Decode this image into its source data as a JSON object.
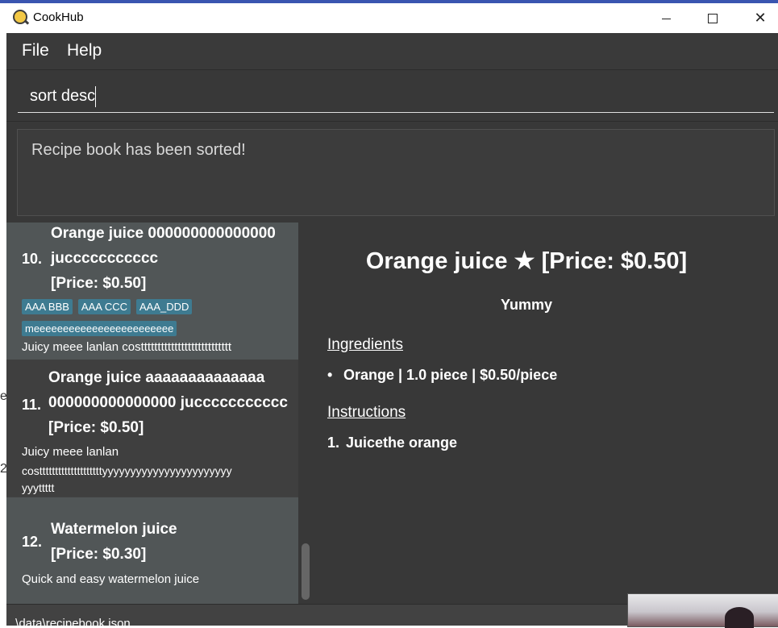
{
  "window": {
    "title": "CookHub"
  },
  "menu": {
    "file": "File",
    "help": "Help"
  },
  "command": {
    "value": "sort desc"
  },
  "result": {
    "message": "Recipe book has been sorted!"
  },
  "background_fragments": [
    "e",
    "2"
  ],
  "recipes": [
    {
      "index": "10.",
      "name_lines": [
        "Orange juice 000000000000000",
        "juccccccccccc",
        "[Price: $0.50]"
      ],
      "tags": [
        "AAA BBB",
        "AAA CCC",
        "AAA_DDD",
        "meeeeeeeeeeeeeeeeeeeeeeee"
      ],
      "description": "Juicy meee lanlan costtttttttttttttttttttttttttt"
    },
    {
      "index": "11.",
      "name_lines": [
        "Orange juice aaaaaaaaaaaaaa",
        "000000000000000 juccccccccccc",
        "[Price: $0.50]"
      ],
      "tags": [],
      "description_lines": [
        "Juicy meee lanlan",
        "costtttttttttttttttttttyyyyyyyyyyyyyyyyyyyyyyy",
        "yyyttttt"
      ]
    },
    {
      "index": "12.",
      "name_lines": [
        "Watermelon juice",
        "[Price: $0.30]"
      ],
      "tags": [],
      "description": "Quick and easy watermelon juice"
    }
  ],
  "detail": {
    "title": "Orange juice ★ [Price: $0.50]",
    "subtitle": "Yummy",
    "ingredients_header": "Ingredients",
    "ingredients": [
      {
        "marker": "•",
        "text": "Orange | 1.0 piece | $0.50/piece"
      }
    ],
    "instructions_header": "Instructions",
    "instructions": [
      {
        "marker": "1.",
        "text": "Juicethe orange"
      }
    ]
  },
  "status": {
    "path": ".\\data\\recipebook.json"
  },
  "colors": {
    "background": "#383838",
    "card_selected": "#515657",
    "tag": "#3e7b91"
  }
}
